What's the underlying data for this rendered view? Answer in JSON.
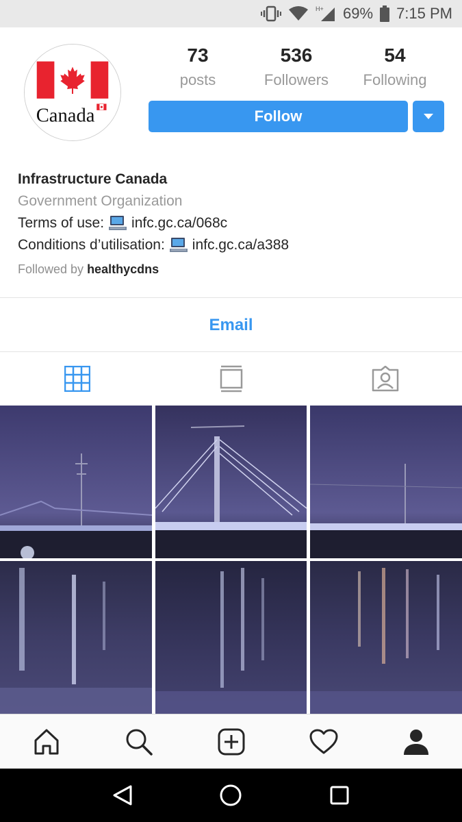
{
  "status_bar": {
    "battery_percent": "69%",
    "time": "7:15 PM",
    "network_label": "H+",
    "icons": [
      "vibrate-icon",
      "wifi-icon",
      "signal-icon",
      "battery-icon"
    ]
  },
  "profile": {
    "avatar_text": "Canada",
    "stats": [
      {
        "value": "73",
        "label": "posts"
      },
      {
        "value": "536",
        "label": "Followers"
      },
      {
        "value": "54",
        "label": "Following"
      }
    ],
    "follow_label": "Follow",
    "name": "Infrastructure Canada",
    "category": "Government Organization",
    "terms_prefix": "Terms of use:",
    "terms_link": "infc.gc.ca/068c",
    "conditions_prefix": "Conditions d’utilisation:",
    "conditions_link": "infc.gc.ca/a388",
    "followed_by_prefix": "Followed by",
    "followed_by_user": "healthycdns",
    "email_label": "Email"
  },
  "tabs": [
    "grid-icon",
    "feed-icon",
    "tagged-icon"
  ],
  "bottom_nav": [
    "home-icon",
    "search-icon",
    "add-post-icon",
    "heart-icon",
    "profile-icon"
  ],
  "system_nav": [
    "back-icon",
    "home-circle-icon",
    "recents-icon"
  ],
  "colors": {
    "accent": "#3897f0",
    "flag_red": "#e8232f",
    "text": "#262626",
    "muted": "#999999",
    "status_bar": "#e9e9e9"
  }
}
